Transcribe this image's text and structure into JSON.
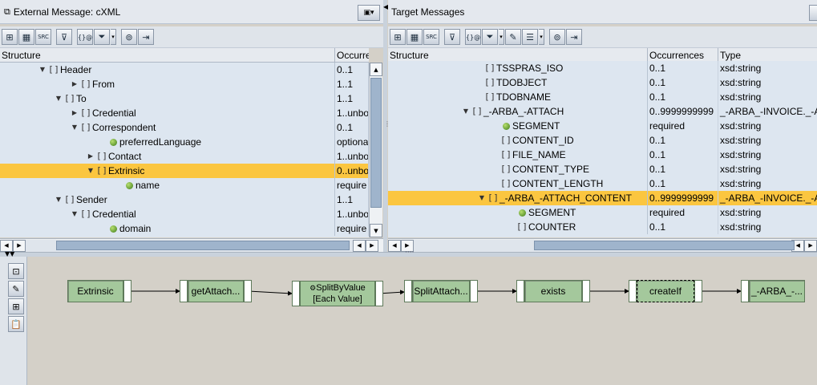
{
  "left_panel": {
    "title": "External Message: cXML",
    "columns": [
      "Structure",
      "Occurre"
    ],
    "rows": [
      {
        "indent": 60,
        "tri": "▼",
        "icon": "bracket",
        "name": "Header",
        "occ": "0..1",
        "sel": false
      },
      {
        "indent": 100,
        "tri": "▶",
        "icon": "bracket",
        "name": "From",
        "occ": "1..1",
        "sel": false
      },
      {
        "indent": 80,
        "tri": "▼",
        "icon": "bracket",
        "name": "To",
        "occ": "1..1",
        "sel": false
      },
      {
        "indent": 100,
        "tri": "▶",
        "icon": "bracket-mixed",
        "name": "Credential",
        "occ": "1..unbo",
        "sel": false
      },
      {
        "indent": 100,
        "tri": "▼",
        "icon": "bracket",
        "name": "Correspondent",
        "occ": "0..1",
        "sel": false
      },
      {
        "indent": 134,
        "tri": "",
        "icon": "leaf",
        "name": "preferredLanguage",
        "occ": "optiona",
        "sel": false
      },
      {
        "indent": 120,
        "tri": "▶",
        "icon": "bracket-mixed",
        "name": "Contact",
        "occ": "1..unbo",
        "sel": false
      },
      {
        "indent": 120,
        "tri": "▼",
        "icon": "bracket-mixed",
        "name": "Extrinsic",
        "occ": "0..unbo",
        "sel": true
      },
      {
        "indent": 154,
        "tri": "",
        "icon": "leaf",
        "name": "name",
        "occ": "require",
        "sel": false
      },
      {
        "indent": 80,
        "tri": "▼",
        "icon": "bracket",
        "name": "Sender",
        "occ": "1..1",
        "sel": false
      },
      {
        "indent": 100,
        "tri": "▼",
        "icon": "bracket-mixed",
        "name": "Credential",
        "occ": "1..unbo",
        "sel": false
      },
      {
        "indent": 134,
        "tri": "",
        "icon": "leaf",
        "name": "domain",
        "occ": "require",
        "sel": false
      }
    ]
  },
  "right_panel": {
    "title": "Target Messages",
    "columns": [
      "Structure",
      "Occurrences",
      "Type"
    ],
    "rows": [
      {
        "indent": 120,
        "tri": "",
        "icon": "bracket",
        "name": "TSSPRAS_ISO",
        "occ": "0..1",
        "type": "xsd:string",
        "sel": false
      },
      {
        "indent": 120,
        "tri": "",
        "icon": "bracket",
        "name": "TDOBJECT",
        "occ": "0..1",
        "type": "xsd:string",
        "sel": false
      },
      {
        "indent": 120,
        "tri": "",
        "icon": "bracket",
        "name": "TDOBNAME",
        "occ": "0..1",
        "type": "xsd:string",
        "sel": false
      },
      {
        "indent": 104,
        "tri": "▼",
        "icon": "bracket-mixed",
        "name": "_-ARBA_-ATTACH",
        "occ": "0..9999999999",
        "type": "_-ARBA_-INVOICE._-A",
        "sel": false
      },
      {
        "indent": 140,
        "tri": "",
        "icon": "leaf",
        "name": "SEGMENT",
        "occ": "required",
        "type": "xsd:string",
        "sel": false
      },
      {
        "indent": 140,
        "tri": "",
        "icon": "bracket",
        "name": "CONTENT_ID",
        "occ": "0..1",
        "type": "xsd:string",
        "sel": false
      },
      {
        "indent": 140,
        "tri": "",
        "icon": "bracket",
        "name": "FILE_NAME",
        "occ": "0..1",
        "type": "xsd:string",
        "sel": false
      },
      {
        "indent": 140,
        "tri": "",
        "icon": "bracket",
        "name": "CONTENT_TYPE",
        "occ": "0..1",
        "type": "xsd:string",
        "sel": false
      },
      {
        "indent": 140,
        "tri": "",
        "icon": "bracket",
        "name": "CONTENT_LENGTH",
        "occ": "0..1",
        "type": "xsd:string",
        "sel": false
      },
      {
        "indent": 124,
        "tri": "▼",
        "icon": "bracket-mixed",
        "name": "_-ARBA_-ATTACH_CONTENT",
        "occ": "0..9999999999",
        "type": "_-ARBA_-INVOICE._-A",
        "sel": true
      },
      {
        "indent": 160,
        "tri": "",
        "icon": "leaf",
        "name": "SEGMENT",
        "occ": "required",
        "type": "xsd:string",
        "sel": false
      },
      {
        "indent": 160,
        "tri": "",
        "icon": "bracket",
        "name": "COUNTER",
        "occ": "0..1",
        "type": "xsd:string",
        "sel": false
      }
    ]
  },
  "mapping": {
    "nodes": [
      {
        "label": "Extrinsic"
      },
      {
        "label": "getAttach..."
      },
      {
        "label_line1": "SplitByValue",
        "label_line2": "[Each Value]"
      },
      {
        "label": "SplitAttach..."
      },
      {
        "label": "exists"
      },
      {
        "label": "createIf"
      },
      {
        "label": "_-ARBA_-..."
      }
    ]
  },
  "colors": {
    "selected_row": "#fbc640",
    "tree_bg": "#dde6f0",
    "node_fill": "#a4c89c"
  }
}
